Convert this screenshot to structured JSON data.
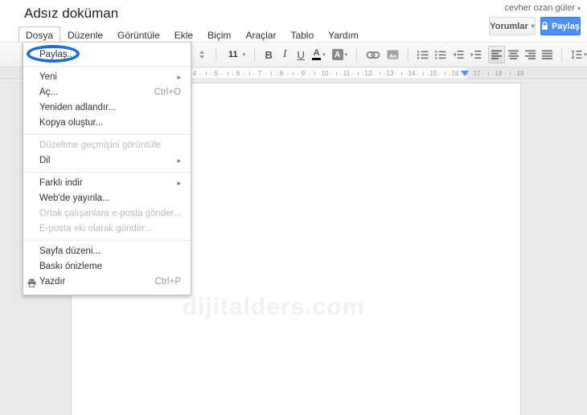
{
  "glyphs": {
    "caret_down": "▾",
    "submenu_arrow": "▸"
  },
  "account": {
    "name": "cevher ozan güler"
  },
  "header": {
    "title": "Adsız doküman",
    "comments_button": "Yorumlar",
    "share_button": "Paylaş",
    "share_color": "#4d90fe"
  },
  "menubar": {
    "items": [
      "Dosya",
      "Düzenle",
      "Görüntüle",
      "Ekle",
      "Biçim",
      "Araçlar",
      "Tablo",
      "Yardım"
    ],
    "open_item": "Dosya"
  },
  "menu_dropdown": {
    "sections": [
      {
        "items": [
          {
            "label": "Paylaş...",
            "annotated": true
          }
        ]
      },
      {
        "items": [
          {
            "label": "Yeni",
            "submenu": true
          },
          {
            "label": "Aç...",
            "shortcut": "Ctrl+O"
          },
          {
            "label": "Yeniden adlandır..."
          },
          {
            "label": "Kopya oluştur..."
          }
        ]
      },
      {
        "items": [
          {
            "label": "Düzeltme geçmişini görüntüle",
            "disabled": true
          },
          {
            "label": "Dil",
            "submenu": true
          }
        ]
      },
      {
        "items": [
          {
            "label": "Farklı indir",
            "submenu": true
          },
          {
            "label": "Web'de yayınla..."
          },
          {
            "label": "Ortak çalışanlara e-posta gönder...",
            "disabled": true
          },
          {
            "label": "E-posta eki olarak gönder...",
            "disabled": true
          }
        ]
      },
      {
        "items": [
          {
            "label": "Sayfa düzeni..."
          },
          {
            "label": "Baskı önizleme"
          },
          {
            "label": "Yazdır",
            "shortcut": "Ctrl+P",
            "icon": "printer"
          }
        ]
      }
    ]
  },
  "toolbar": {
    "font_size": "11",
    "bold": "B",
    "italic": "I",
    "underline": "U",
    "text_color": "A",
    "highlight": "A",
    "icons": [
      "style-spinner-icon",
      "font-size-select",
      "bold",
      "italic",
      "underline",
      "text-color",
      "highlight-color",
      "insert-link-icon",
      "insert-image-icon",
      "numbered-list-icon",
      "bulleted-list-icon",
      "decrease-indent-icon",
      "increase-indent-icon",
      "align-left-icon",
      "align-center-icon",
      "align-right-icon",
      "align-justify-icon",
      "line-spacing-icon"
    ]
  },
  "ruler": {
    "numbers": [
      "4",
      "5",
      "6",
      "7",
      "8",
      "9",
      "10",
      "11",
      "12",
      "13",
      "14",
      "15",
      "16",
      "17",
      "18",
      "19"
    ]
  },
  "page": {
    "watermark": "dijitalders.com"
  },
  "annotation": {
    "color": "#1d6fd1",
    "target": "Paylaş..."
  }
}
